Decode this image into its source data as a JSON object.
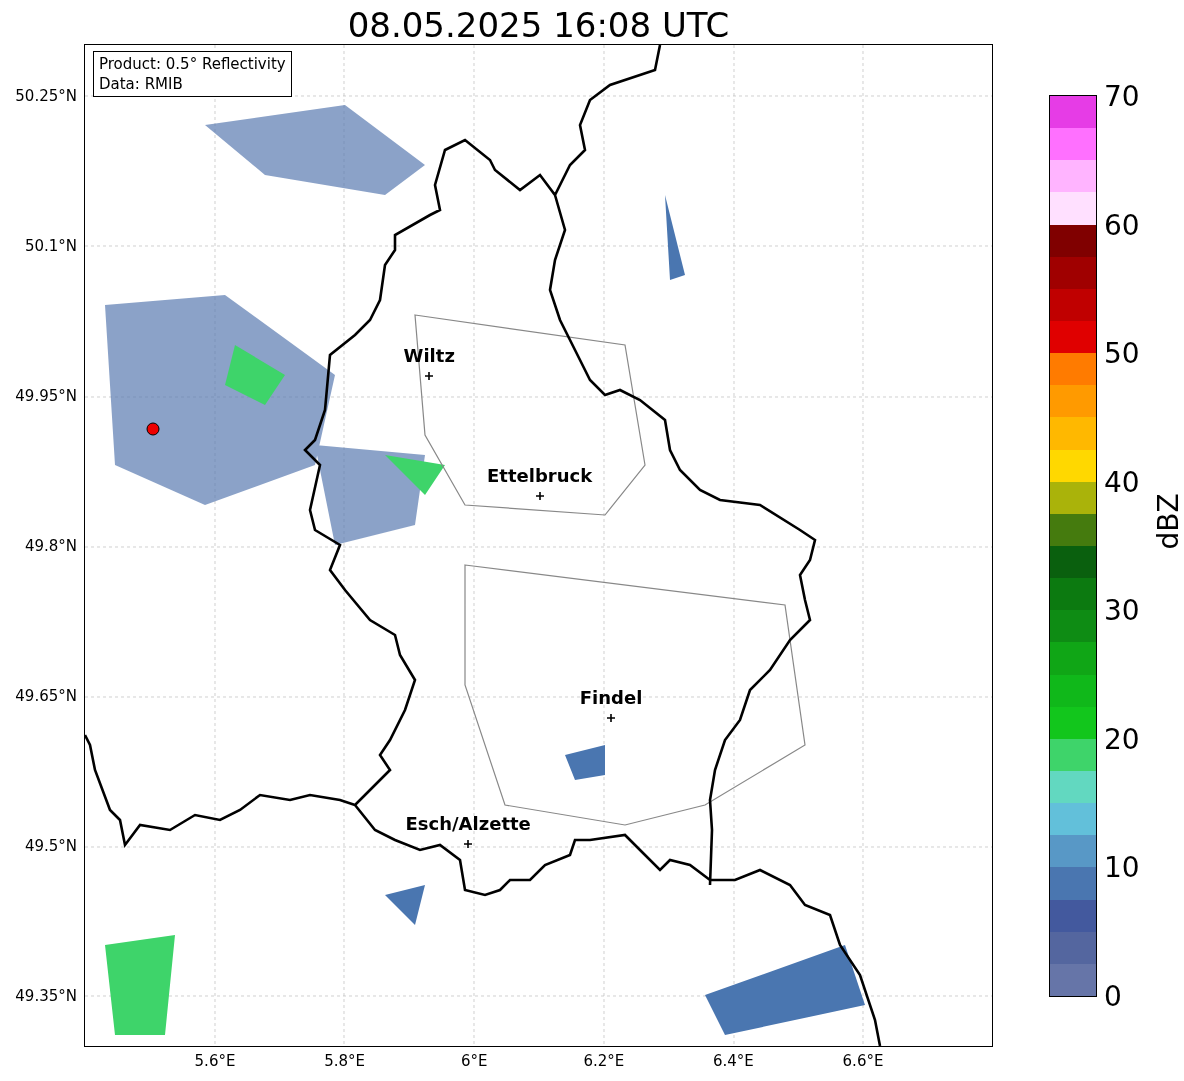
{
  "title": "08.05.2025 16:08 UTC",
  "info_box": [
    "Product: 0.5° Reflectivity",
    "Data: RMIB"
  ],
  "lat_ticks": [
    "50.25°N",
    "50.1°N",
    "49.95°N",
    "49.8°N",
    "49.65°N",
    "49.5°N",
    "49.35°N"
  ],
  "lon_ticks": [
    "5.6°E",
    "5.8°E",
    "6°E",
    "6.2°E",
    "6.4°E",
    "6.6°E"
  ],
  "cities": [
    {
      "name": "Wiltz"
    },
    {
      "name": "Ettelbruck"
    },
    {
      "name": "Findel"
    },
    {
      "name": "Esch/Alzette"
    }
  ],
  "colorbar": {
    "label": "dBZ",
    "ticks": [
      "70",
      "60",
      "50",
      "40",
      "30",
      "20",
      "10",
      "0"
    ]
  }
}
